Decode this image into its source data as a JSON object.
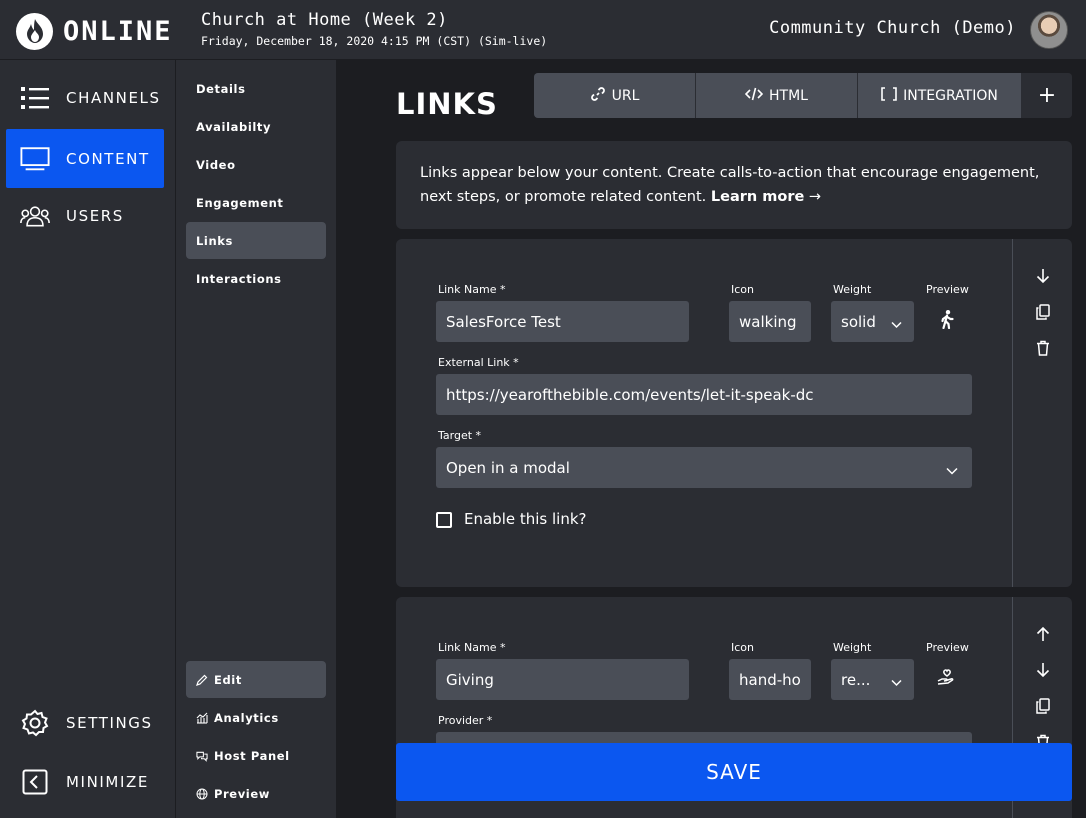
{
  "app": {
    "logo_text": "ONLINE",
    "title": "Church at Home (Week 2)",
    "subtitle": "Friday, December 18, 2020 4:15 PM (CST) (Sim-live)",
    "org_name": "Community Church (Demo)"
  },
  "leftnav": {
    "channels": "CHANNELS",
    "content": "CONTENT",
    "users": "USERS",
    "settings": "SETTINGS",
    "minimize": "MINIMIZE"
  },
  "subnav": {
    "details": "Details",
    "availability": "Availabilty",
    "video": "Video",
    "engagement": "Engagement",
    "links": "Links",
    "interactions": "Interactions",
    "edit": "Edit",
    "analytics": "Analytics",
    "host_panel": "Host Panel",
    "preview": "Preview"
  },
  "main": {
    "title": "LINKS",
    "tabs": {
      "url": "URL",
      "html": "HTML",
      "integration": "INTEGRATION",
      "plus": "+"
    },
    "info_text": "Links appear below your content. Create calls-to-action that encourage engagement, next steps, or promote related content.",
    "learn_more": "Learn more",
    "learn_more_arrow": "→",
    "save": "SAVE"
  },
  "link1": {
    "name_label": "Link Name *",
    "name_value": "SalesForce Test",
    "icon_label": "Icon",
    "icon_value": "walking",
    "weight_label": "Weight",
    "weight_value": "solid",
    "preview_label": "Preview",
    "external_label": "External Link *",
    "external_value": "https://yearofthebible.com/events/let-it-speak-dc",
    "target_label": "Target *",
    "target_value": "Open in a modal",
    "enable_label": "Enable this link?",
    "enabled": false
  },
  "link2": {
    "name_label": "Link Name *",
    "name_value": "Giving",
    "icon_label": "Icon",
    "icon_value": "hand-ho",
    "weight_label": "Weight",
    "weight_value": "re...",
    "preview_label": "Preview",
    "provider_label": "Provider *"
  },
  "colors": {
    "accent": "#0b57f0",
    "panel": "#2b2d33",
    "background": "#1c1d21",
    "field": "#4a4e57"
  }
}
